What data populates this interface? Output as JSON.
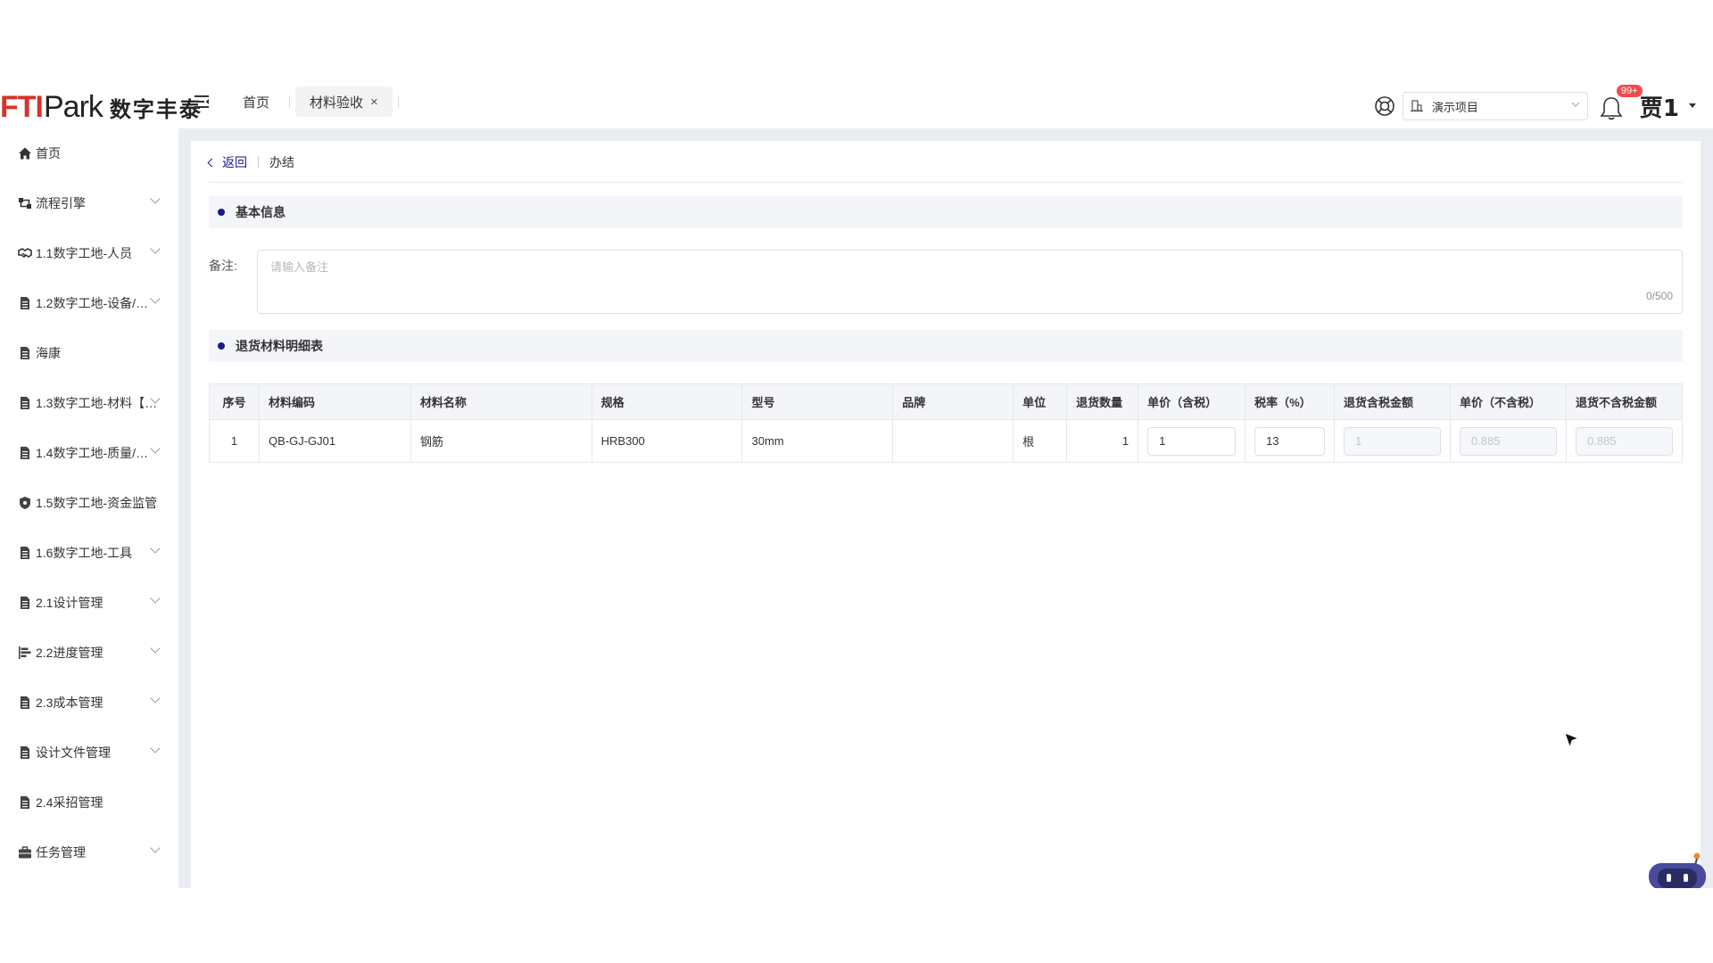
{
  "header": {
    "logo_fti": "FTI",
    "logo_park": "Park",
    "logo_cn": "数字丰泰",
    "tabs": [
      {
        "label": "首页",
        "active": false
      },
      {
        "label": "材料验收",
        "active": true,
        "close": "×"
      }
    ],
    "project_select": {
      "value": "演示项目"
    },
    "notification_badge": "99+",
    "user_name": "贾1"
  },
  "sidebar": {
    "items": [
      {
        "label": "首页",
        "icon": "home-icon",
        "expandable": false
      },
      {
        "label": "流程引擎",
        "icon": "flow-icon",
        "expandable": true
      },
      {
        "label": "1.1数字工地-人员",
        "icon": "handshake-icon",
        "expandable": true
      },
      {
        "label": "1.2数字工地-设备/…",
        "icon": "document-icon",
        "expandable": true
      },
      {
        "label": "海康",
        "icon": "document-icon",
        "expandable": false
      },
      {
        "label": "1.3数字工地-材料【…",
        "icon": "document-icon",
        "expandable": true
      },
      {
        "label": "1.4数字工地-质量/…",
        "icon": "document-icon",
        "expandable": true
      },
      {
        "label": "1.5数字工地-资金监管",
        "icon": "shield-icon",
        "expandable": false
      },
      {
        "label": "1.6数字工地-工具",
        "icon": "document-icon",
        "expandable": true
      },
      {
        "label": "2.1设计管理",
        "icon": "document-icon",
        "expandable": true
      },
      {
        "label": "2.2进度管理",
        "icon": "gantt-icon",
        "expandable": true
      },
      {
        "label": "2.3成本管理",
        "icon": "document-icon",
        "expandable": true
      },
      {
        "label": "设计文件管理",
        "icon": "document-icon",
        "expandable": true
      },
      {
        "label": "2.4采招管理",
        "icon": "document-icon",
        "expandable": false
      },
      {
        "label": "任务管理",
        "icon": "briefcase-icon",
        "expandable": true
      }
    ]
  },
  "breadcrumb": {
    "back": "返回",
    "title": "办结"
  },
  "basic_info": {
    "title": "基本信息",
    "remark_label": "备注:",
    "remark_placeholder": "请输入备注",
    "remark_value": "",
    "remark_count": "0/500"
  },
  "detail": {
    "title": "退货材料明细表",
    "columns": [
      "序号",
      "材料编码",
      "材料名称",
      "规格",
      "型号",
      "品牌",
      "单位",
      "退货数量",
      "单价（含税）",
      "税率（%）",
      "退货含税金额",
      "单价（不含税）",
      "退货不含税金额"
    ],
    "rows": [
      {
        "index": "1",
        "code": "QB-GJ-GJ01",
        "name": "钢筋",
        "spec": "HRB300",
        "model": "30mm",
        "brand": "",
        "unit": "根",
        "qty": "1",
        "price_tax": "1",
        "tax_rate": "13",
        "amount_tax": "1",
        "price_notax": "0.885",
        "amount_notax": "0.885"
      }
    ]
  },
  "colors": {
    "brand_red": "#d6332b",
    "accent_navy": "#1a1a8c",
    "badge_red": "#f24b4b",
    "content_bg": "#e9edf2"
  }
}
